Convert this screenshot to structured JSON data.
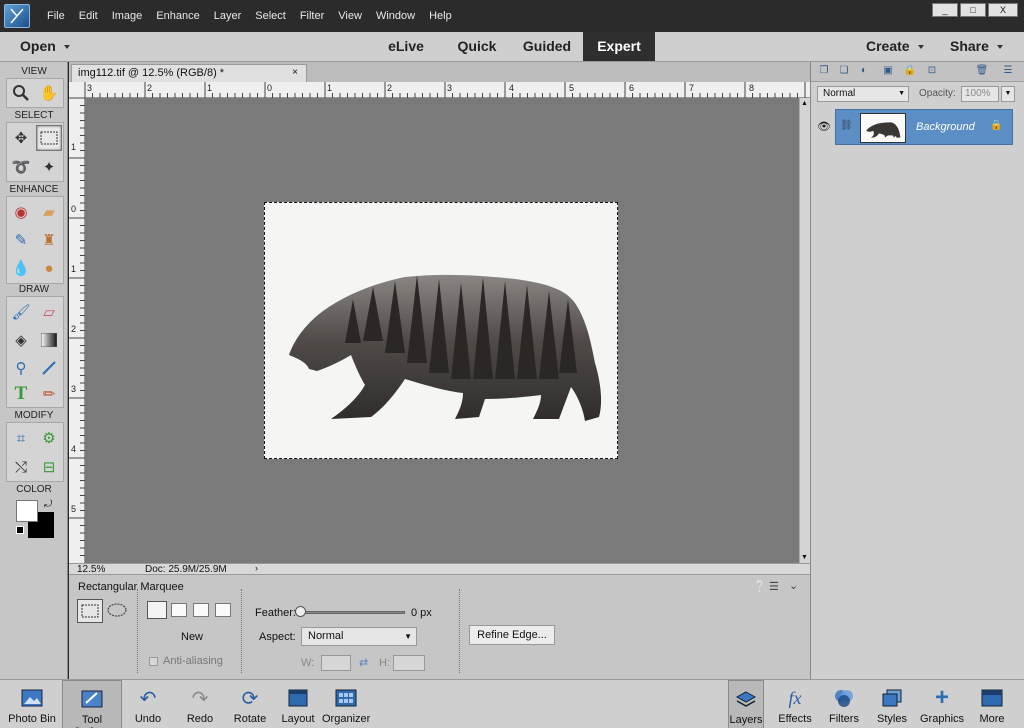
{
  "menu": [
    "File",
    "Edit",
    "Image",
    "Enhance",
    "Layer",
    "Select",
    "Filter",
    "View",
    "Window",
    "Help"
  ],
  "window_buttons": [
    "_",
    "□",
    "X"
  ],
  "modebar": {
    "open": "Open",
    "elive": "eLive",
    "quick": "Quick",
    "guided": "Guided",
    "expert": "Expert",
    "create": "Create",
    "share": "Share"
  },
  "toolbox": {
    "view": "VIEW",
    "select": "SELECT",
    "enhance": "ENHANCE",
    "draw": "DRAW",
    "modify": "MODIFY",
    "color": "COLOR"
  },
  "document": {
    "tab_title": "img112.tif @ 12.5% (RGB/8) *",
    "close": "×",
    "zoom": "12.5%",
    "doc_size": "Doc: 25.9M/25.9M"
  },
  "rulers": {
    "h": [
      "3",
      "2",
      "1",
      "0",
      "1",
      "2",
      "3",
      "4",
      "5",
      "6",
      "7",
      "8"
    ],
    "v": [
      "1",
      "0",
      "1",
      "2",
      "3",
      "4",
      "5"
    ]
  },
  "tool_options": {
    "title": "Rectangular Marquee",
    "new_label": "New",
    "anti_alias_label": "Anti-aliasing",
    "feather_label": "Feather:",
    "feather_value": "0 px",
    "feather_fraction": 0,
    "aspect_label": "Aspect:",
    "aspect_value": "Normal",
    "w_label": "W:",
    "h_label": "H:",
    "refine_button": "Refine Edge..."
  },
  "layers_panel": {
    "blend_mode": "Normal",
    "opacity_label": "Opacity:",
    "opacity_value": "100%",
    "layer_name": "Background"
  },
  "bottom_left": [
    {
      "label": "Photo Bin",
      "icon": "photo-bin-icon"
    },
    {
      "label": "Tool Options",
      "icon": "tool-options-icon"
    },
    {
      "label": "Undo",
      "icon": "undo-icon"
    },
    {
      "label": "Redo",
      "icon": "redo-icon"
    },
    {
      "label": "Rotate",
      "icon": "rotate-icon"
    },
    {
      "label": "Layout",
      "icon": "layout-icon"
    },
    {
      "label": "Organizer",
      "icon": "organizer-icon"
    }
  ],
  "bottom_right": [
    {
      "label": "Layers",
      "icon": "layers-icon"
    },
    {
      "label": "Effects",
      "icon": "effects-icon"
    },
    {
      "label": "Filters",
      "icon": "filters-icon"
    },
    {
      "label": "Styles",
      "icon": "styles-icon"
    },
    {
      "label": "Graphics",
      "icon": "graphics-icon"
    },
    {
      "label": "More",
      "icon": "more-icon"
    }
  ],
  "colors": {
    "accent": "#5b8ec4",
    "canvas": "#7a7a7a",
    "chrome_dark": "#2b2b2b",
    "panel": "#c6c6c6"
  }
}
